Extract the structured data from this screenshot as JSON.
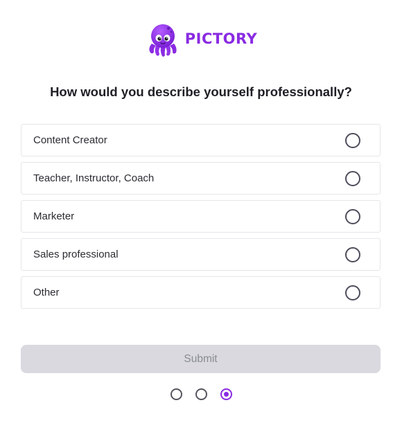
{
  "brand": {
    "name": "PICTORY",
    "logo_icon": "octopus-icon",
    "color": "#8a2be2"
  },
  "question": {
    "text": "How would you describe yourself professionally?"
  },
  "options": [
    {
      "label": "Content Creator",
      "selected": false
    },
    {
      "label": "Teacher, Instructor, Coach",
      "selected": false
    },
    {
      "label": "Marketer",
      "selected": false
    },
    {
      "label": "Sales professional",
      "selected": false
    },
    {
      "label": "Other",
      "selected": false
    }
  ],
  "submit": {
    "label": "Submit",
    "disabled": true
  },
  "pagination": {
    "total_steps": 3,
    "current_step": 3
  }
}
